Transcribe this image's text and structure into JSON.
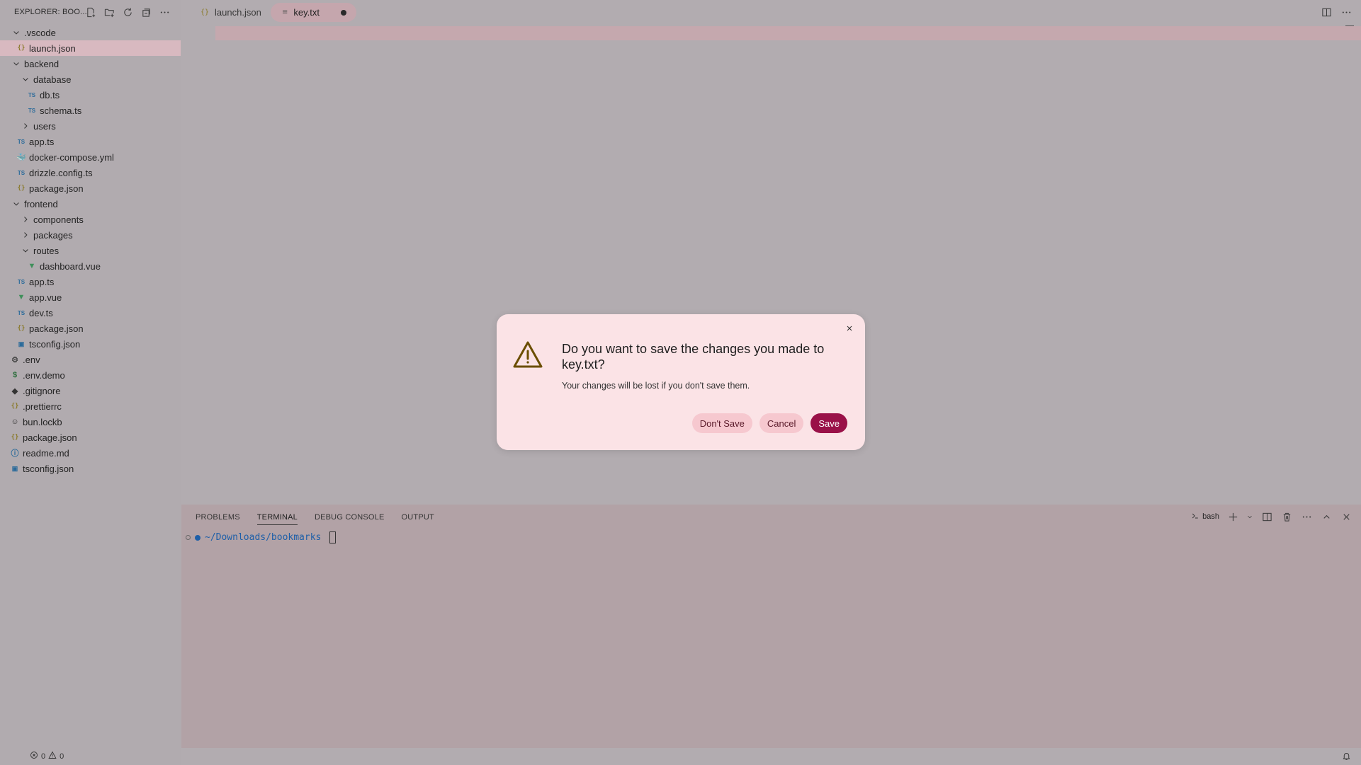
{
  "explorer": {
    "title": "EXPLORER: BOO...",
    "actions": [
      "new-file-icon",
      "new-folder-icon",
      "refresh-icon",
      "collapse-all-icon",
      "more-icon"
    ]
  },
  "tree": [
    {
      "label": ".vscode",
      "type": "folder",
      "open": true,
      "depth": 0
    },
    {
      "label": "launch.json",
      "type": "json",
      "depth": 1,
      "selected": true
    },
    {
      "label": "backend",
      "type": "folder",
      "open": true,
      "depth": 0
    },
    {
      "label": "database",
      "type": "folder",
      "open": true,
      "depth": 1
    },
    {
      "label": "db.ts",
      "type": "ts",
      "depth": 2
    },
    {
      "label": "schema.ts",
      "type": "ts",
      "depth": 2
    },
    {
      "label": "users",
      "type": "folder",
      "open": false,
      "depth": 1
    },
    {
      "label": "app.ts",
      "type": "ts",
      "depth": 1
    },
    {
      "label": "docker-compose.yml",
      "type": "yml",
      "depth": 1
    },
    {
      "label": "drizzle.config.ts",
      "type": "ts",
      "depth": 1
    },
    {
      "label": "package.json",
      "type": "json",
      "depth": 1
    },
    {
      "label": "frontend",
      "type": "folder",
      "open": true,
      "depth": 0
    },
    {
      "label": "components",
      "type": "folder",
      "open": false,
      "depth": 1
    },
    {
      "label": "packages",
      "type": "folder",
      "open": false,
      "depth": 1
    },
    {
      "label": "routes",
      "type": "folder",
      "open": true,
      "depth": 1
    },
    {
      "label": "dashboard.vue",
      "type": "vue",
      "depth": 2
    },
    {
      "label": "app.ts",
      "type": "ts",
      "depth": 1
    },
    {
      "label": "app.vue",
      "type": "vue",
      "depth": 1
    },
    {
      "label": "dev.ts",
      "type": "ts",
      "depth": 1
    },
    {
      "label": "package.json",
      "type": "json",
      "depth": 1
    },
    {
      "label": "tsconfig.json",
      "type": "tsconfig",
      "depth": 1
    },
    {
      "label": ".env",
      "type": "gear",
      "depth": 0
    },
    {
      "label": ".env.demo",
      "type": "dollar",
      "depth": 0
    },
    {
      "label": ".gitignore",
      "type": "git",
      "depth": 0
    },
    {
      "label": ".prettierrc",
      "type": "json",
      "depth": 0
    },
    {
      "label": "bun.lockb",
      "type": "bun",
      "depth": 0
    },
    {
      "label": "package.json",
      "type": "json",
      "depth": 0
    },
    {
      "label": "readme.md",
      "type": "info",
      "depth": 0
    },
    {
      "label": "tsconfig.json",
      "type": "tsconfig",
      "depth": 0
    }
  ],
  "tabs": [
    {
      "label": "launch.json",
      "icon": "{}",
      "active": false
    },
    {
      "label": "key.txt",
      "icon": "≡",
      "active": true,
      "dirty": true
    }
  ],
  "panel": {
    "tabs": [
      "PROBLEMS",
      "TERMINAL",
      "DEBUG CONSOLE",
      "OUTPUT"
    ],
    "active_tab": "TERMINAL",
    "shell": "bash",
    "terminal_path": "~/Downloads/bookmarks"
  },
  "status": {
    "errors": "0",
    "warnings": "0"
  },
  "dialog": {
    "title": "Do you want to save the changes you made to key.txt?",
    "message": "Your changes will be lost if you don't save them.",
    "buttons": {
      "dont_save": "Don't Save",
      "cancel": "Cancel",
      "save": "Save"
    }
  },
  "colors": {
    "accent": "#9a1148",
    "dialog_bg": "#fbe3e6",
    "selection": "#d8b9c0",
    "terminal_path": "#1e5fa8"
  }
}
